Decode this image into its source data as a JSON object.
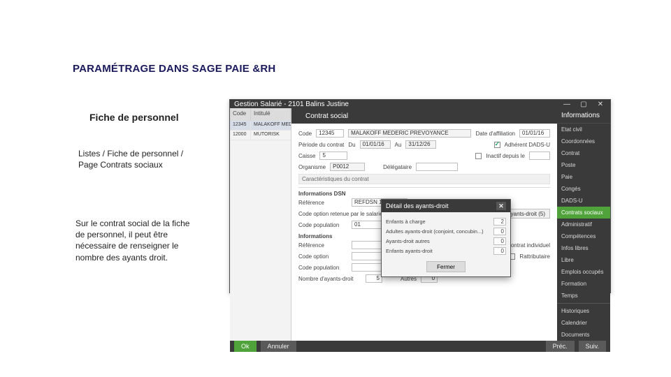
{
  "title_main": "PARAMÉTRAGE DANS SAGE PAIE &RH",
  "subtitle": "Fiche de personnel",
  "path": "Listes / Fiche de personnel /  Page Contrats sociaux",
  "desc": "Sur le contrat social de la fiche  de personnel, il peut être  nécessaire de renseigner le  nombre des ayants droit.",
  "window": {
    "title": "Gestion Salarié - 2101 Balins Justine",
    "tab": "Contrat social",
    "right_header": "Informations",
    "right_items": [
      "Etat civil",
      "Coordonnées",
      "Contrat",
      "Poste",
      "Paie",
      "Congés",
      "DADS-U",
      "Contrats sociaux",
      "Administratif",
      "Compétences",
      "Infos libres",
      "Libre",
      "Emplois occupés",
      "Formation",
      "Temps"
    ],
    "right_items_sep": [
      "Historiques",
      "Calendrier",
      "Documents"
    ],
    "right_selected_index": 7,
    "left_headers": {
      "c1": "Code",
      "c2": "Intitulé"
    },
    "left_rows": [
      {
        "code": "12345",
        "intitule": "MALAKOFF MEDER"
      },
      {
        "code": "12000",
        "intitule": "MUTORISK"
      }
    ],
    "form": {
      "code_label": "Code",
      "code": "12345",
      "code_desc": "MALAKOFF MEDERIC PREVOYANCE",
      "date_aff_label": "Date d'affiliation",
      "date_aff": "01/01/16",
      "periode_label": "Période du contrat",
      "du_label": "Du",
      "du": "01/01/16",
      "au_label": "Au",
      "au": "31/12/26",
      "adherent_label": "Adhérent DADS-U",
      "caisse_label": "Caisse",
      "caisse": "5",
      "inactif_label": "Inactif  depuis le",
      "organisme_label": "Organisme",
      "organisme": "P0012",
      "delegataire_label": "Délégataire",
      "carac_label": "Caractéristiques du contrat",
      "info_dsn": "Informations DSN",
      "ref_label": "Référence",
      "ref": "REFDSN 1",
      "code_opt_label": "Code option retenue par le salarié",
      "code_pop_label": "Code population",
      "code_pop": "01",
      "ayants_btn": "Ayants-droit (5)",
      "info_section": "Informations",
      "ref2_label": "Référence",
      "code_opt2_label": "Code option",
      "code_pop2_label": "Code population",
      "nb_ayants_label": "Nombre d'ayants-droit",
      "nb_ayants": "5",
      "autres_label": "Autres",
      "autres": "0",
      "contrat_indiv_label": "Contrat individuel",
      "rattributaire_label": "Rattributaire"
    },
    "footer": {
      "ok": "Ok",
      "annuler": "Annuler",
      "prec": "Préc.",
      "suiv": "Suiv."
    }
  },
  "modal": {
    "title": "Détail des ayants-droit",
    "rows": [
      {
        "label": "Enfants à charge",
        "val": "2"
      },
      {
        "label": "Adultes ayants-droit (conjoint, concubin...)",
        "val": "0"
      },
      {
        "label": "Ayants-droit autres",
        "val": "0"
      },
      {
        "label": "Enfants ayants-droit",
        "val": "0"
      }
    ],
    "close": "Fermer"
  }
}
